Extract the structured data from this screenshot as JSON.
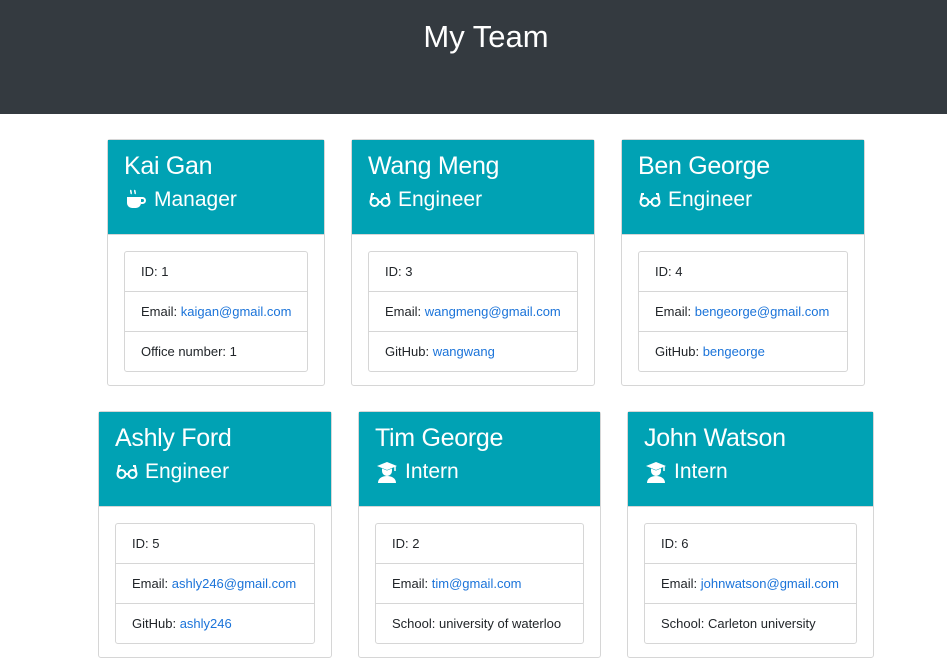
{
  "page": {
    "title": "My Team"
  },
  "cards": [
    {
      "name": "Kai Gan",
      "role": "Manager",
      "icon": "coffee-icon",
      "id_label": "ID: 1",
      "email_prefix": "Email: ",
      "email": "kaigan@gmail.com",
      "extra_prefix": "Office number: 1",
      "extra_value": ""
    },
    {
      "name": "Wang Meng",
      "role": "Engineer",
      "icon": "glasses-icon",
      "id_label": "ID: 3",
      "email_prefix": "Email: ",
      "email": "wangmeng@gmail.com",
      "extra_prefix": "GitHub: ",
      "extra_value": "wangwang"
    },
    {
      "name": "Ben George",
      "role": "Engineer",
      "icon": "glasses-icon",
      "id_label": "ID: 4",
      "email_prefix": "Email: ",
      "email": "bengeorge@gmail.com",
      "extra_prefix": "GitHub: ",
      "extra_value": "bengeorge"
    },
    {
      "name": "Ashly Ford",
      "role": "Engineer",
      "icon": "glasses-icon",
      "id_label": "ID: 5",
      "email_prefix": "Email: ",
      "email": "ashly246@gmail.com",
      "extra_prefix": "GitHub: ",
      "extra_value": "ashly246"
    },
    {
      "name": "Tim George",
      "role": "Intern",
      "icon": "graduate-icon",
      "id_label": "ID: 2",
      "email_prefix": "Email: ",
      "email": "tim@gmail.com",
      "extra_prefix": "School: university of waterloo",
      "extra_value": ""
    },
    {
      "name": "John Watson",
      "role": "Intern",
      "icon": "graduate-icon",
      "id_label": "ID: 6",
      "email_prefix": "Email: ",
      "email": "johnwatson@gmail.com",
      "extra_prefix": "School: Carleton university",
      "extra_value": ""
    }
  ],
  "colors": {
    "header_bg": "#343a40",
    "card_head_bg": "#00a2b4",
    "link": "#1a73d9"
  }
}
